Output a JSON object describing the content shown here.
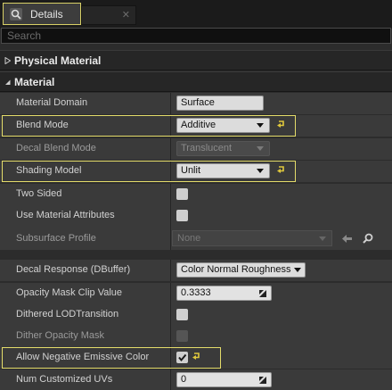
{
  "tab": {
    "title": "Details"
  },
  "search": {
    "placeholder": "Search"
  },
  "categories": {
    "physical_material": "Physical Material",
    "material": "Material"
  },
  "properties": {
    "material_domain": {
      "label": "Material Domain",
      "value": "Surface"
    },
    "blend_mode": {
      "label": "Blend Mode",
      "value": "Additive"
    },
    "decal_blend_mode": {
      "label": "Decal Blend Mode",
      "value": "Translucent"
    },
    "shading_model": {
      "label": "Shading Model",
      "value": "Unlit"
    },
    "two_sided": {
      "label": "Two Sided",
      "checked": false
    },
    "use_material_attributes": {
      "label": "Use Material Attributes",
      "checked": false
    },
    "subsurface_profile": {
      "label": "Subsurface Profile",
      "value": "None"
    },
    "decal_response": {
      "label": "Decal Response (DBuffer)",
      "value": "Color Normal Roughness"
    },
    "opacity_mask_clip_value": {
      "label": "Opacity Mask Clip Value",
      "value": "0.3333"
    },
    "dithered_lod_transition": {
      "label": "Dithered LODTransition",
      "checked": false
    },
    "dither_opacity_mask": {
      "label": "Dither Opacity Mask",
      "checked": false
    },
    "allow_negative_emissive_color": {
      "label": "Allow Negative Emissive Color",
      "checked": true
    },
    "num_customized_uvs": {
      "label": "Num Customized UVs",
      "value": "0"
    }
  },
  "colors": {
    "panel_bg": "#2c2c2c",
    "row_bg": "#3a3a3a",
    "highlight": "#e4dc6a",
    "reset_arrow": "#e0c83c"
  }
}
